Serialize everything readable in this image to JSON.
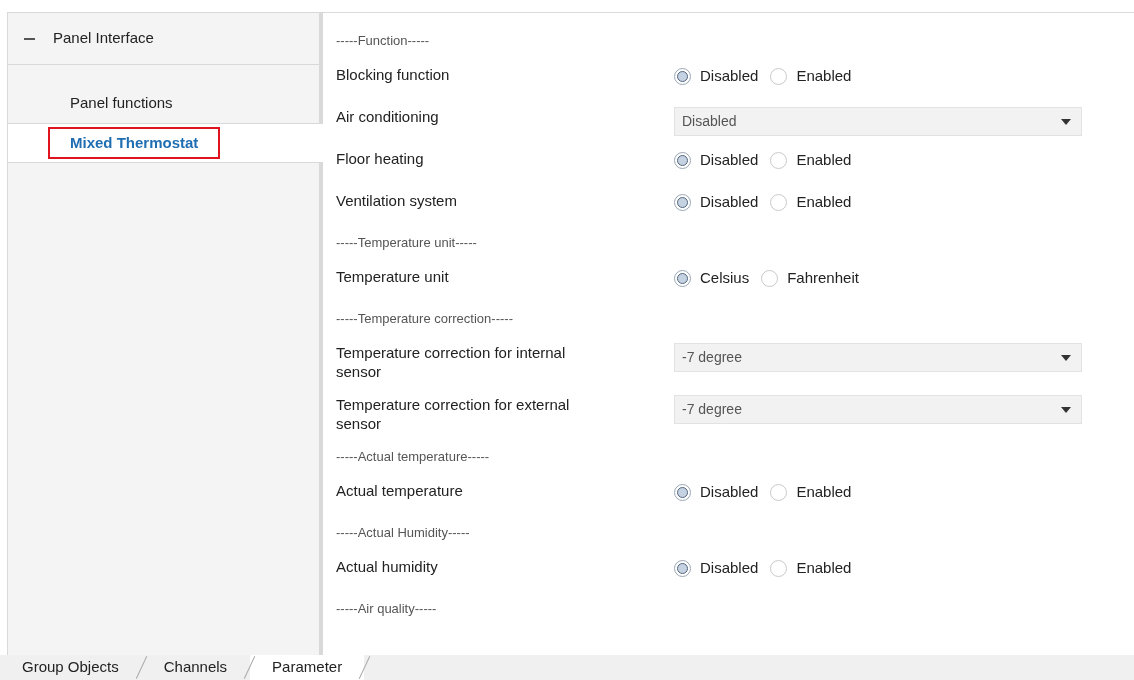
{
  "sidebar": {
    "group": {
      "label": "Panel Interface",
      "expanded": true
    },
    "items": [
      {
        "label": "Panel functions",
        "selected": false
      },
      {
        "label": "Mixed Thermostat",
        "selected": true
      }
    ]
  },
  "parameters": [
    {
      "kind": "section",
      "label": "-----Function-----"
    },
    {
      "kind": "radio",
      "label": "Blocking function",
      "options": [
        {
          "label": "Disabled",
          "selected": true
        },
        {
          "label": "Enabled",
          "selected": false
        }
      ]
    },
    {
      "kind": "dropdown",
      "label": "Air conditioning",
      "value": "Disabled"
    },
    {
      "kind": "radio",
      "label": "Floor heating",
      "options": [
        {
          "label": "Disabled",
          "selected": true
        },
        {
          "label": "Enabled",
          "selected": false
        }
      ]
    },
    {
      "kind": "radio",
      "label": "Ventilation system",
      "options": [
        {
          "label": "Disabled",
          "selected": true
        },
        {
          "label": "Enabled",
          "selected": false
        }
      ]
    },
    {
      "kind": "section",
      "label": "-----Temperature unit-----"
    },
    {
      "kind": "radio",
      "label": "Temperature unit",
      "options": [
        {
          "label": "Celsius",
          "selected": true
        },
        {
          "label": "Fahrenheit",
          "selected": false
        }
      ]
    },
    {
      "kind": "section",
      "label": "-----Temperature correction-----"
    },
    {
      "kind": "dropdown",
      "label": "Temperature correction for internal sensor",
      "value": "-7 degree"
    },
    {
      "kind": "dropdown",
      "label": "Temperature correction for external sensor",
      "value": "-7 degree"
    },
    {
      "kind": "section",
      "label": "-----Actual temperature-----"
    },
    {
      "kind": "radio",
      "label": "Actual temperature",
      "options": [
        {
          "label": "Disabled",
          "selected": true
        },
        {
          "label": "Enabled",
          "selected": false
        }
      ]
    },
    {
      "kind": "section",
      "label": "-----Actual Humidity-----"
    },
    {
      "kind": "radio",
      "label": "Actual humidity",
      "options": [
        {
          "label": "Disabled",
          "selected": true
        },
        {
          "label": "Enabled",
          "selected": false
        }
      ]
    },
    {
      "kind": "section",
      "label": "-----Air quality-----"
    }
  ],
  "tabs": [
    {
      "label": "Group Objects",
      "selected": false
    },
    {
      "label": "Channels",
      "selected": false
    },
    {
      "label": "Parameter",
      "selected": true
    }
  ]
}
